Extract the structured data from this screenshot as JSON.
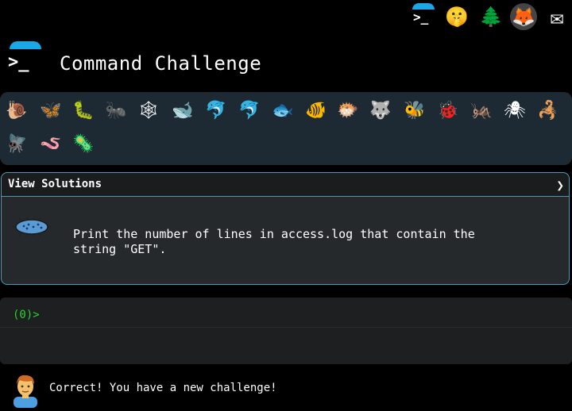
{
  "header": {
    "title": "Command Challenge"
  },
  "topbar": {
    "icons": [
      {
        "name": "terminal-icon",
        "glyph": "terminal"
      },
      {
        "name": "shush-face-icon",
        "glyph": "🤫"
      },
      {
        "name": "tree-icon",
        "glyph": "🌲"
      },
      {
        "name": "gitlab-icon",
        "glyph": "🦊"
      },
      {
        "name": "mail-icon",
        "glyph": "✉"
      }
    ]
  },
  "critters": [
    "🐌",
    "🦋",
    "🐛",
    "🐜",
    "🕸",
    "🐋",
    "🐬",
    "🐬",
    "🐟",
    "🐠",
    "🐡",
    "🐺",
    "🐝",
    "🐞",
    "🦗",
    "🕷",
    "🦂",
    "🪰",
    "🪱",
    "🦠"
  ],
  "challenge": {
    "view_solutions_label": "View Solutions",
    "chevron": "❯",
    "text": "Print the number of lines in access.log that contain the\nstring \"GET\"."
  },
  "terminal": {
    "prompt": "(0)>",
    "input_value": "",
    "input_placeholder": ""
  },
  "status": {
    "message": "Correct! You have a new challenge!"
  },
  "colors": {
    "accent": "#3b9fbd",
    "prompt_green": "#28d428",
    "umbrella_blue": "#1aa7e6",
    "critter_strip_bg": "#1e2a33"
  }
}
